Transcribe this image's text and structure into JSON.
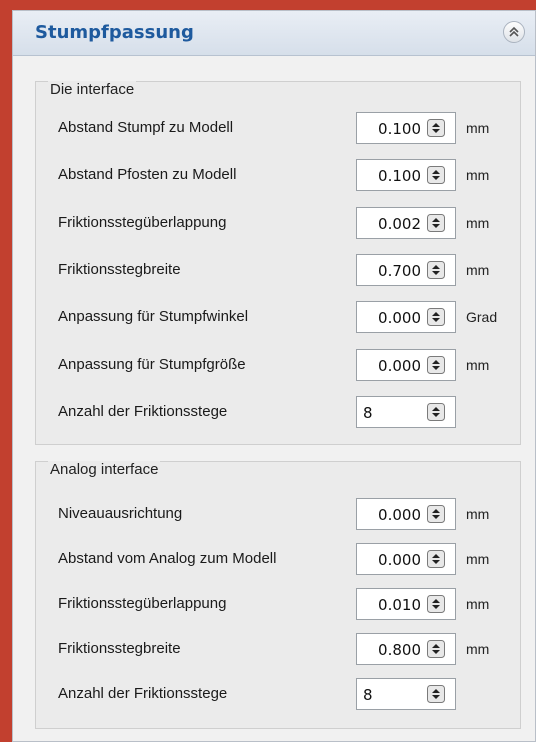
{
  "panel": {
    "title": "Stumpfpassung"
  },
  "groups": [
    {
      "title": "Die interface",
      "rows": [
        {
          "label": "Abstand Stumpf zu Modell",
          "value": "0.100",
          "unit": "mm"
        },
        {
          "label": "Abstand Pfosten zu Modell",
          "value": "0.100",
          "unit": "mm"
        },
        {
          "label": "Friktionsstegüberlappung",
          "value": "0.002",
          "unit": "mm"
        },
        {
          "label": "Friktionsstegbreite",
          "value": "0.700",
          "unit": "mm"
        },
        {
          "label": "Anpassung für Stumpfwinkel",
          "value": "0.000",
          "unit": "Grad"
        },
        {
          "label": "Anpassung für Stumpfgröße",
          "value": "0.000",
          "unit": "mm"
        },
        {
          "label": "Anzahl der Friktionsstege",
          "value": "8",
          "unit": ""
        }
      ]
    },
    {
      "title": "Analog interface",
      "rows": [
        {
          "label": "Niveauausrichtung",
          "value": "0.000",
          "unit": "mm"
        },
        {
          "label": "Abstand vom Analog zum Modell",
          "value": "0.000",
          "unit": "mm"
        },
        {
          "label": "Friktionsstegüberlappung",
          "value": "0.010",
          "unit": "mm"
        },
        {
          "label": "Friktionsstegbreite",
          "value": "0.800",
          "unit": "mm"
        },
        {
          "label": "Anzahl der Friktionsstege",
          "value": "8",
          "unit": ""
        }
      ]
    }
  ],
  "icons": {
    "collapse": "chevron-double-up-icon",
    "spinner": "spinner-arrows-icon"
  },
  "colors": {
    "title": "#1e5a9e",
    "background_outer": "#c2402f",
    "panel_bg": "#f1f1f1"
  }
}
